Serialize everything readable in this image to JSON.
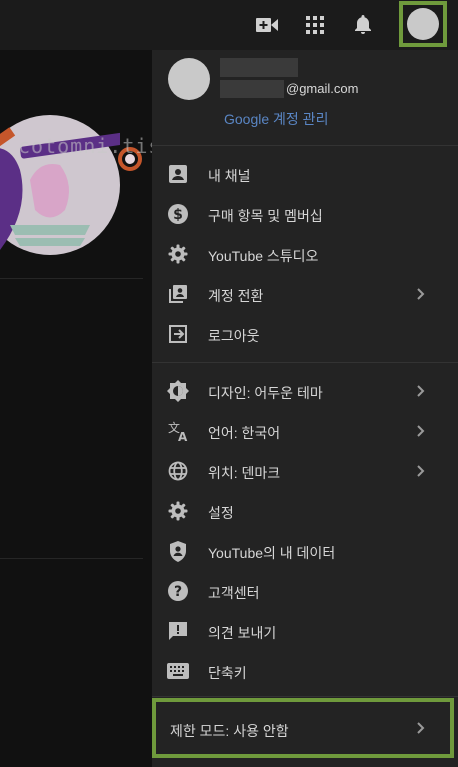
{
  "topbar": {
    "icons": [
      "video-camera-icon",
      "apps-grid-icon",
      "bell-icon"
    ]
  },
  "watermark": "cotomni.tistory.com",
  "account": {
    "email_suffix": "@gmail.com",
    "manage_link": "Google 계정 관리"
  },
  "menu": {
    "group1": [
      {
        "label": "내 채널",
        "icon": "account-box-icon"
      },
      {
        "label": "구매 항목 및 멤버십",
        "icon": "dollar-icon"
      },
      {
        "label": "YouTube 스튜디오",
        "icon": "gear-icon"
      },
      {
        "label": "계정 전환",
        "icon": "switch-account-icon",
        "chevron": true
      },
      {
        "label": "로그아웃",
        "icon": "logout-icon"
      }
    ],
    "group2": [
      {
        "label": "디자인: 어두운 테마",
        "icon": "theme-icon",
        "chevron": true
      },
      {
        "label": "언어: 한국어",
        "icon": "translate-icon",
        "chevron": true
      },
      {
        "label": "위치: 덴마크",
        "icon": "globe-icon",
        "chevron": true
      },
      {
        "label": "설정",
        "icon": "gear-icon"
      },
      {
        "label": "YouTube의 내 데이터",
        "icon": "shield-person-icon"
      },
      {
        "label": "고객센터",
        "icon": "help-icon"
      },
      {
        "label": "의견 보내기",
        "icon": "feedback-icon"
      },
      {
        "label": "단축키",
        "icon": "keyboard-icon"
      }
    ],
    "restricted_mode": "제한 모드: 사용 안함"
  },
  "colors": {
    "highlight": "#6f9a3c",
    "menu_bg": "#232323",
    "link": "#5a86c4"
  }
}
